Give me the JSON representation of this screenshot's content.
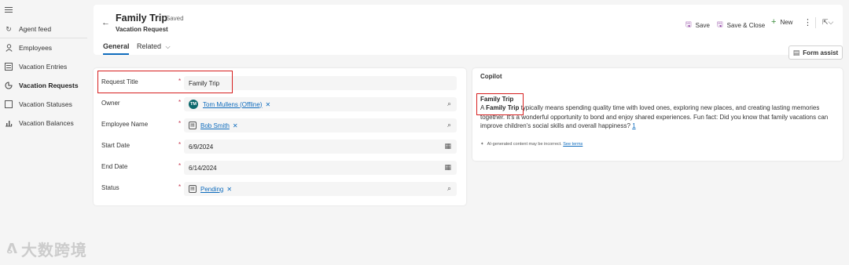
{
  "sidebar": {
    "items": [
      {
        "label": "Agent feed",
        "icon": "refresh-icon"
      },
      {
        "label": "Employees",
        "icon": "person-icon"
      },
      {
        "label": "Vacation Entries",
        "icon": "list-icon"
      },
      {
        "label": "Vacation Requests",
        "icon": "chart-icon"
      },
      {
        "label": "Vacation Statuses",
        "icon": "square-icon"
      },
      {
        "label": "Vacation Balances",
        "icon": "bar-chart-icon"
      }
    ]
  },
  "header": {
    "title": "Family Trip",
    "status": "- Saved",
    "entity": "Vacation Request",
    "tabs": {
      "general": "General",
      "related": "Related"
    }
  },
  "commands": {
    "save": "Save",
    "save_close": "Save & Close",
    "new": "New",
    "form_assist": "Form assist"
  },
  "form": {
    "request_title": {
      "label": "Request Title",
      "value": "Family Trip"
    },
    "owner": {
      "label": "Owner",
      "value": "Tom Mullens (Offline)",
      "initials": "TM"
    },
    "employee_name": {
      "label": "Employee Name",
      "value": "Bob Smith"
    },
    "start_date": {
      "label": "Start Date",
      "value": "6/9/2024"
    },
    "end_date": {
      "label": "End Date",
      "value": "6/14/2024"
    },
    "status": {
      "label": "Status",
      "value": "Pending"
    }
  },
  "copilot": {
    "title": "Copilot",
    "response_title": "Family Trip",
    "response_pre": "A ",
    "response_bold": "Family Trip",
    "response_text": " typically means spending quality time with loved ones, exploring new places, and creating lasting memories together. It's a wonderful opportunity to bond and enjoy shared experiences. Fun fact: Did you know that family vacations can improve children's social skills and overall happiness? ",
    "reference": "1",
    "disclaimer": "AI-generated content may be incorrect.",
    "see_terms": "See terms"
  },
  "watermark": "大数跨境",
  "colors": {
    "accent": "#0f6cbd",
    "highlight_box": "#d61f1f",
    "required": "#c4314b"
  }
}
